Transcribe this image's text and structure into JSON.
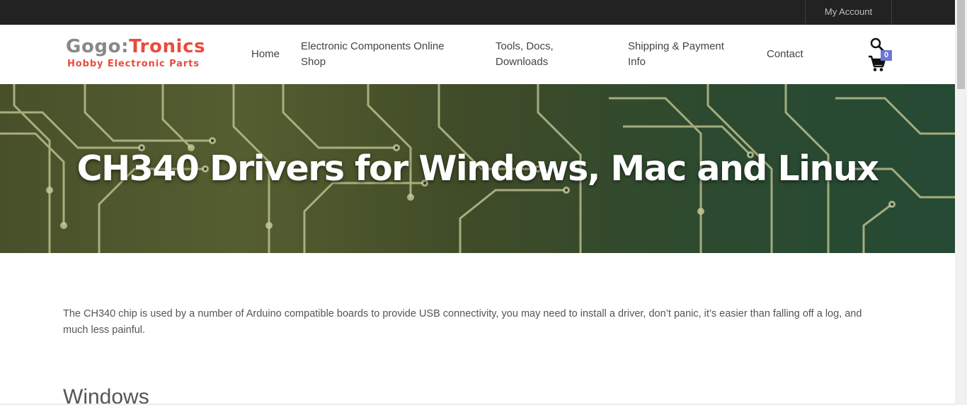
{
  "topbar": {
    "account_label": "My Account"
  },
  "logo": {
    "part1": "Gogo:",
    "part2": "Tronics",
    "tagline": "Hobby Electronic Parts"
  },
  "nav": {
    "home": "Home",
    "shop_line1": "Electronic Components Online",
    "shop_line2": "Shop",
    "tools_line1": "Tools, Docs,",
    "tools_line2": "Downloads",
    "shipping_line1": "Shipping & Payment",
    "shipping_line2": "Info",
    "contact": "Contact"
  },
  "cart": {
    "count": "0"
  },
  "icons": {
    "search": "search-icon",
    "cart": "cart-icon"
  },
  "hero": {
    "title": "CH340 Drivers for Windows, Mac and Linux"
  },
  "content": {
    "intro": "The CH340 chip is used by a number of Arduino compatible boards to provide USB connectivity, you may need to install a driver, don’t panic, it’s easier than falling off a log, and much less painful.",
    "section_title": "Windows"
  },
  "colors": {
    "brand_red": "#e84c3d",
    "logo_gray": "#888888",
    "topbar": "#222222",
    "badge": "#6a77d6"
  }
}
